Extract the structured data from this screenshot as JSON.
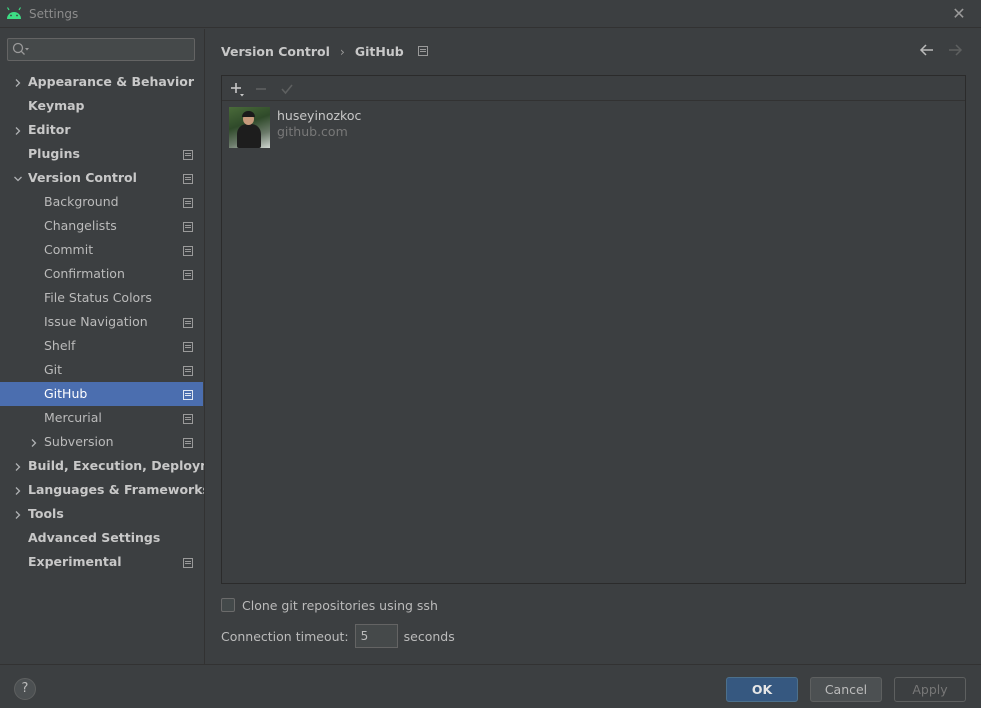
{
  "window": {
    "title": "Settings",
    "close_glyph": "✕"
  },
  "search": {
    "placeholder": "",
    "value": ""
  },
  "sidebar": {
    "items": [
      {
        "label": "Appearance & Behavior",
        "bold": true,
        "level": 0,
        "expander": "collapsed",
        "project_icon": false
      },
      {
        "label": "Keymap",
        "bold": true,
        "level": 0,
        "expander": "none",
        "project_icon": false
      },
      {
        "label": "Editor",
        "bold": true,
        "level": 0,
        "expander": "collapsed",
        "project_icon": false
      },
      {
        "label": "Plugins",
        "bold": true,
        "level": 0,
        "expander": "none",
        "project_icon": true
      },
      {
        "label": "Version Control",
        "bold": true,
        "level": 0,
        "expander": "expanded",
        "project_icon": true
      },
      {
        "label": "Background",
        "bold": false,
        "level": 1,
        "expander": "none",
        "project_icon": true
      },
      {
        "label": "Changelists",
        "bold": false,
        "level": 1,
        "expander": "none",
        "project_icon": true
      },
      {
        "label": "Commit",
        "bold": false,
        "level": 1,
        "expander": "none",
        "project_icon": true
      },
      {
        "label": "Confirmation",
        "bold": false,
        "level": 1,
        "expander": "none",
        "project_icon": true
      },
      {
        "label": "File Status Colors",
        "bold": false,
        "level": 1,
        "expander": "none",
        "project_icon": false
      },
      {
        "label": "Issue Navigation",
        "bold": false,
        "level": 1,
        "expander": "none",
        "project_icon": true
      },
      {
        "label": "Shelf",
        "bold": false,
        "level": 1,
        "expander": "none",
        "project_icon": true
      },
      {
        "label": "Git",
        "bold": false,
        "level": 1,
        "expander": "none",
        "project_icon": true
      },
      {
        "label": "GitHub",
        "bold": false,
        "level": 1,
        "expander": "none",
        "project_icon": true,
        "selected": true
      },
      {
        "label": "Mercurial",
        "bold": false,
        "level": 1,
        "expander": "none",
        "project_icon": true
      },
      {
        "label": "Subversion",
        "bold": false,
        "level": 1,
        "expander": "collapsed",
        "project_icon": true
      },
      {
        "label": "Build, Execution, Deployment",
        "bold": true,
        "level": 0,
        "expander": "collapsed",
        "project_icon": false
      },
      {
        "label": "Languages & Frameworks",
        "bold": true,
        "level": 0,
        "expander": "collapsed",
        "project_icon": false
      },
      {
        "label": "Tools",
        "bold": true,
        "level": 0,
        "expander": "collapsed",
        "project_icon": false
      },
      {
        "label": "Advanced Settings",
        "bold": true,
        "level": 0,
        "expander": "none",
        "project_icon": false
      },
      {
        "label": "Experimental",
        "bold": true,
        "level": 0,
        "expander": "none",
        "project_icon": true
      }
    ]
  },
  "breadcrumb": {
    "parent": "Version Control",
    "separator": "›",
    "current": "GitHub"
  },
  "accounts": {
    "toolbar": {
      "add": "+",
      "remove": "−",
      "default": "✓"
    },
    "list": [
      {
        "username": "huseyinozkoc",
        "host": "github.com"
      }
    ]
  },
  "clone_ssh": {
    "label": "Clone git repositories using ssh",
    "checked": false
  },
  "timeout": {
    "label": "Connection timeout:",
    "value": "5",
    "unit": "seconds"
  },
  "footer": {
    "help": "?",
    "ok": "OK",
    "cancel": "Cancel",
    "apply": "Apply"
  },
  "colors": {
    "background": "#3c3f41",
    "selection": "#4b6eaf",
    "ok_button": "#365880",
    "android_green": "#3ddc84"
  }
}
